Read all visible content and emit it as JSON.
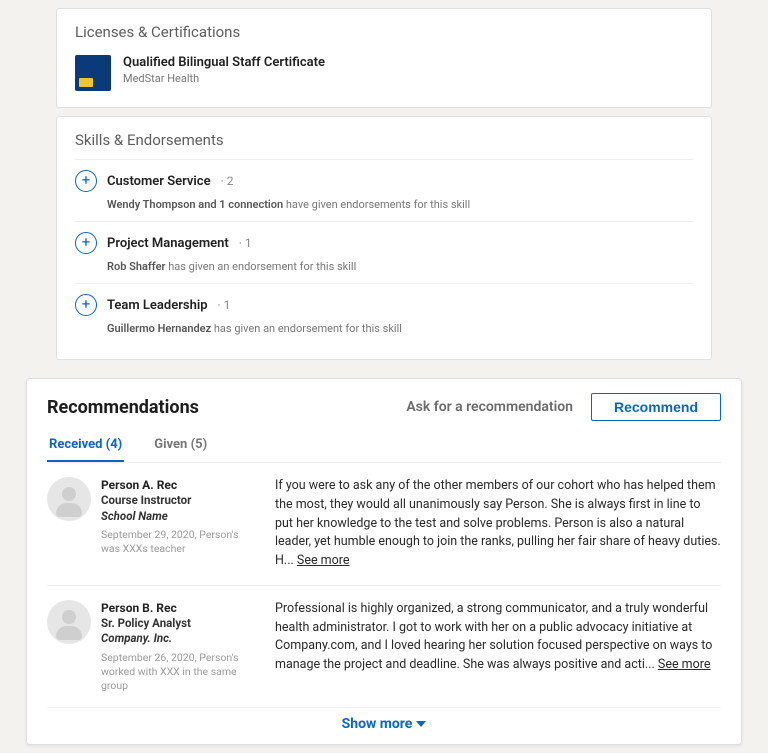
{
  "licenses": {
    "title": "Licenses & Certifications",
    "item": {
      "name": "Qualified Bilingual Staff Certificate",
      "issuer": "MedStar Health"
    }
  },
  "skills": {
    "title": "Skills & Endorsements",
    "items": [
      {
        "name": "Customer Service",
        "count": "· 2",
        "endorsers_bold": "Wendy Thompson and 1 connection",
        "endorsers_rest": " have given endorsements for this skill"
      },
      {
        "name": "Project Management",
        "count": "· 1",
        "endorsers_bold": "Rob Shaffer",
        "endorsers_rest": " has given an endorsement for this skill"
      },
      {
        "name": "Team Leadership",
        "count": "· 1",
        "endorsers_bold": "Guillermo Hernandez",
        "endorsers_rest": " has given an endorsement for this skill"
      }
    ]
  },
  "recs": {
    "title": "Recommendations",
    "ask": "Ask for a recommendation",
    "recommend_btn": "Recommend",
    "tabs": {
      "received": "Received (4)",
      "given": "Given (5)"
    },
    "items": [
      {
        "name": "Person A. Rec",
        "role": "Course Instructor",
        "org": "School Name",
        "date": "September 29, 2020, Person's was   XXXs   teacher",
        "body": "If you were to ask any of the other members of our cohort who has helped them the most, they would all unanimously say Person. She is always first in line to put her knowledge to the test and solve problems. Person is also a natural leader, yet humble enough to join the ranks, pulling her fair share of heavy duties. H... ",
        "more": "See more"
      },
      {
        "name": "Person B. Rec",
        "role": "Sr. Policy Analyst",
        "org": "Company. Inc.",
        "date": "September 26, 2020, Person's worked with XXX  in the same group",
        "body": "Professional is highly organized, a strong communicator, and a truly wonderful health administrator.  I got to work with her on a public advocacy initiative at Company.com, and I loved hearing her solution focused perspective on ways to manage the project and deadline. She  was always positive and acti... ",
        "more": "See more"
      }
    ],
    "show_more": "Show more"
  }
}
